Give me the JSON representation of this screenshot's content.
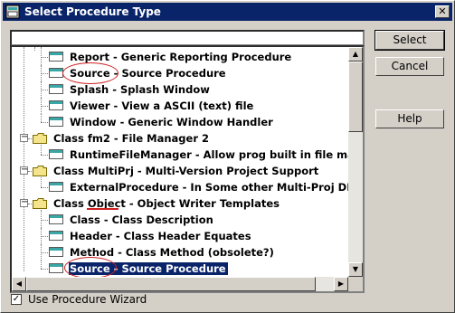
{
  "window": {
    "title": "Select Procedure Type",
    "close_glyph": "✕"
  },
  "search": {
    "value": ""
  },
  "buttons": {
    "select": "Select",
    "cancel": "Cancel",
    "help": "Help"
  },
  "tree": [
    {
      "kind": "item",
      "label": "Report - Generic Reporting Procedure"
    },
    {
      "kind": "item",
      "label": "Source - Source Procedure"
    },
    {
      "kind": "item",
      "label": "Splash - Splash Window"
    },
    {
      "kind": "item",
      "label": "Viewer - View a ASCII (text) file"
    },
    {
      "kind": "item",
      "label": "Window - Generic Window Handler"
    },
    {
      "kind": "class",
      "label": "Class fm2 - File Manager 2",
      "expander": "−"
    },
    {
      "kind": "item",
      "label": "RuntimeFileManager - Allow prog built in file manageme"
    },
    {
      "kind": "class",
      "label": "Class MultiPrj - Multi-Version Project Support",
      "expander": "−"
    },
    {
      "kind": "item",
      "label": "ExternalProcedure - In Some other Multi-Proj DLL or Li"
    },
    {
      "kind": "class",
      "label": "Class Object - Object Writer Templates",
      "expander": "−"
    },
    {
      "kind": "item",
      "label": "Class - Class Description"
    },
    {
      "kind": "item",
      "label": "Header - Class Header Equates"
    },
    {
      "kind": "item",
      "label": "Method - Class Method (obsolete?)"
    },
    {
      "kind": "item",
      "label": "Source - Source Procedure",
      "selected": true
    }
  ],
  "scroll_glyphs": {
    "up": "▲",
    "down": "▼",
    "left": "◀",
    "right": "▶"
  },
  "options": {
    "use_wizard_label": "Use Procedure Wizard",
    "use_wizard_checked": true,
    "check_glyph": "✓"
  },
  "colors": {
    "selection": "#0a246a",
    "annotation": "#cc2020"
  }
}
